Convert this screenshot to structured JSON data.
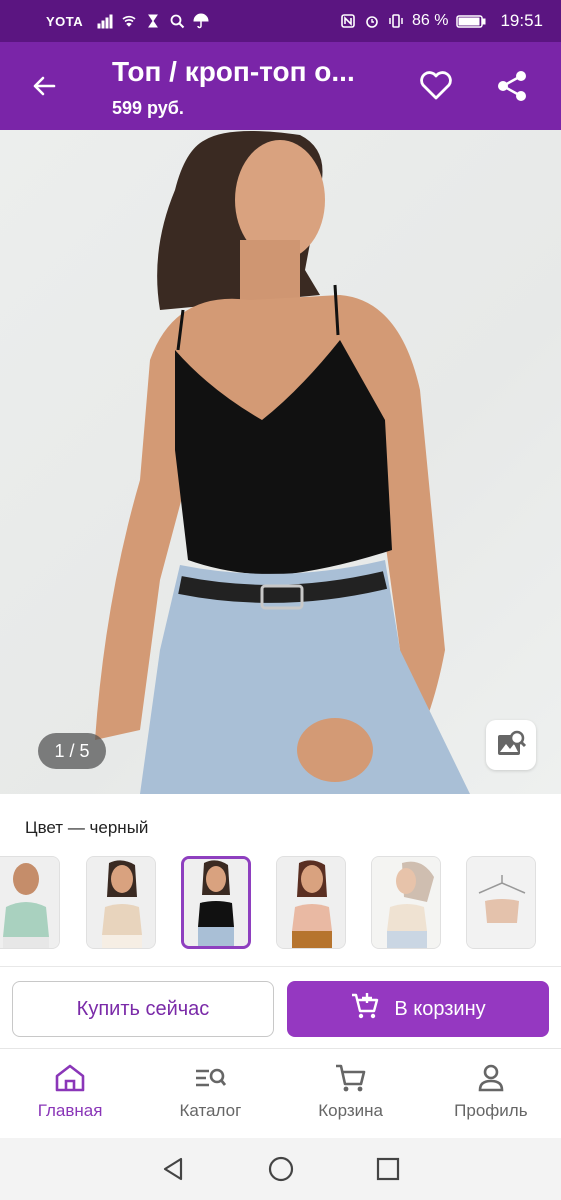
{
  "status_bar": {
    "carrier": "YOTA",
    "battery": "86 %",
    "time": "19:51"
  },
  "header": {
    "title": "Топ / кроп-топ о...",
    "price": "599 руб."
  },
  "photo": {
    "pager": "1 / 5"
  },
  "color": {
    "label": "Цвет — черный",
    "thumbs": [
      "mint",
      "beige",
      "black",
      "peach",
      "cream",
      "pink-hanger"
    ]
  },
  "actions": {
    "buy_now": "Купить сейчас",
    "to_cart": "В корзину"
  },
  "nav": {
    "items": [
      {
        "label": "Главная",
        "icon": "home-icon"
      },
      {
        "label": "Каталог",
        "icon": "catalog-search-icon"
      },
      {
        "label": "Корзина",
        "icon": "cart-icon"
      },
      {
        "label": "Профиль",
        "icon": "profile-icon"
      }
    ]
  },
  "colors": {
    "status_bar": "#5b1581",
    "app_bar": "#7a25a8",
    "accent": "#9538c1"
  }
}
